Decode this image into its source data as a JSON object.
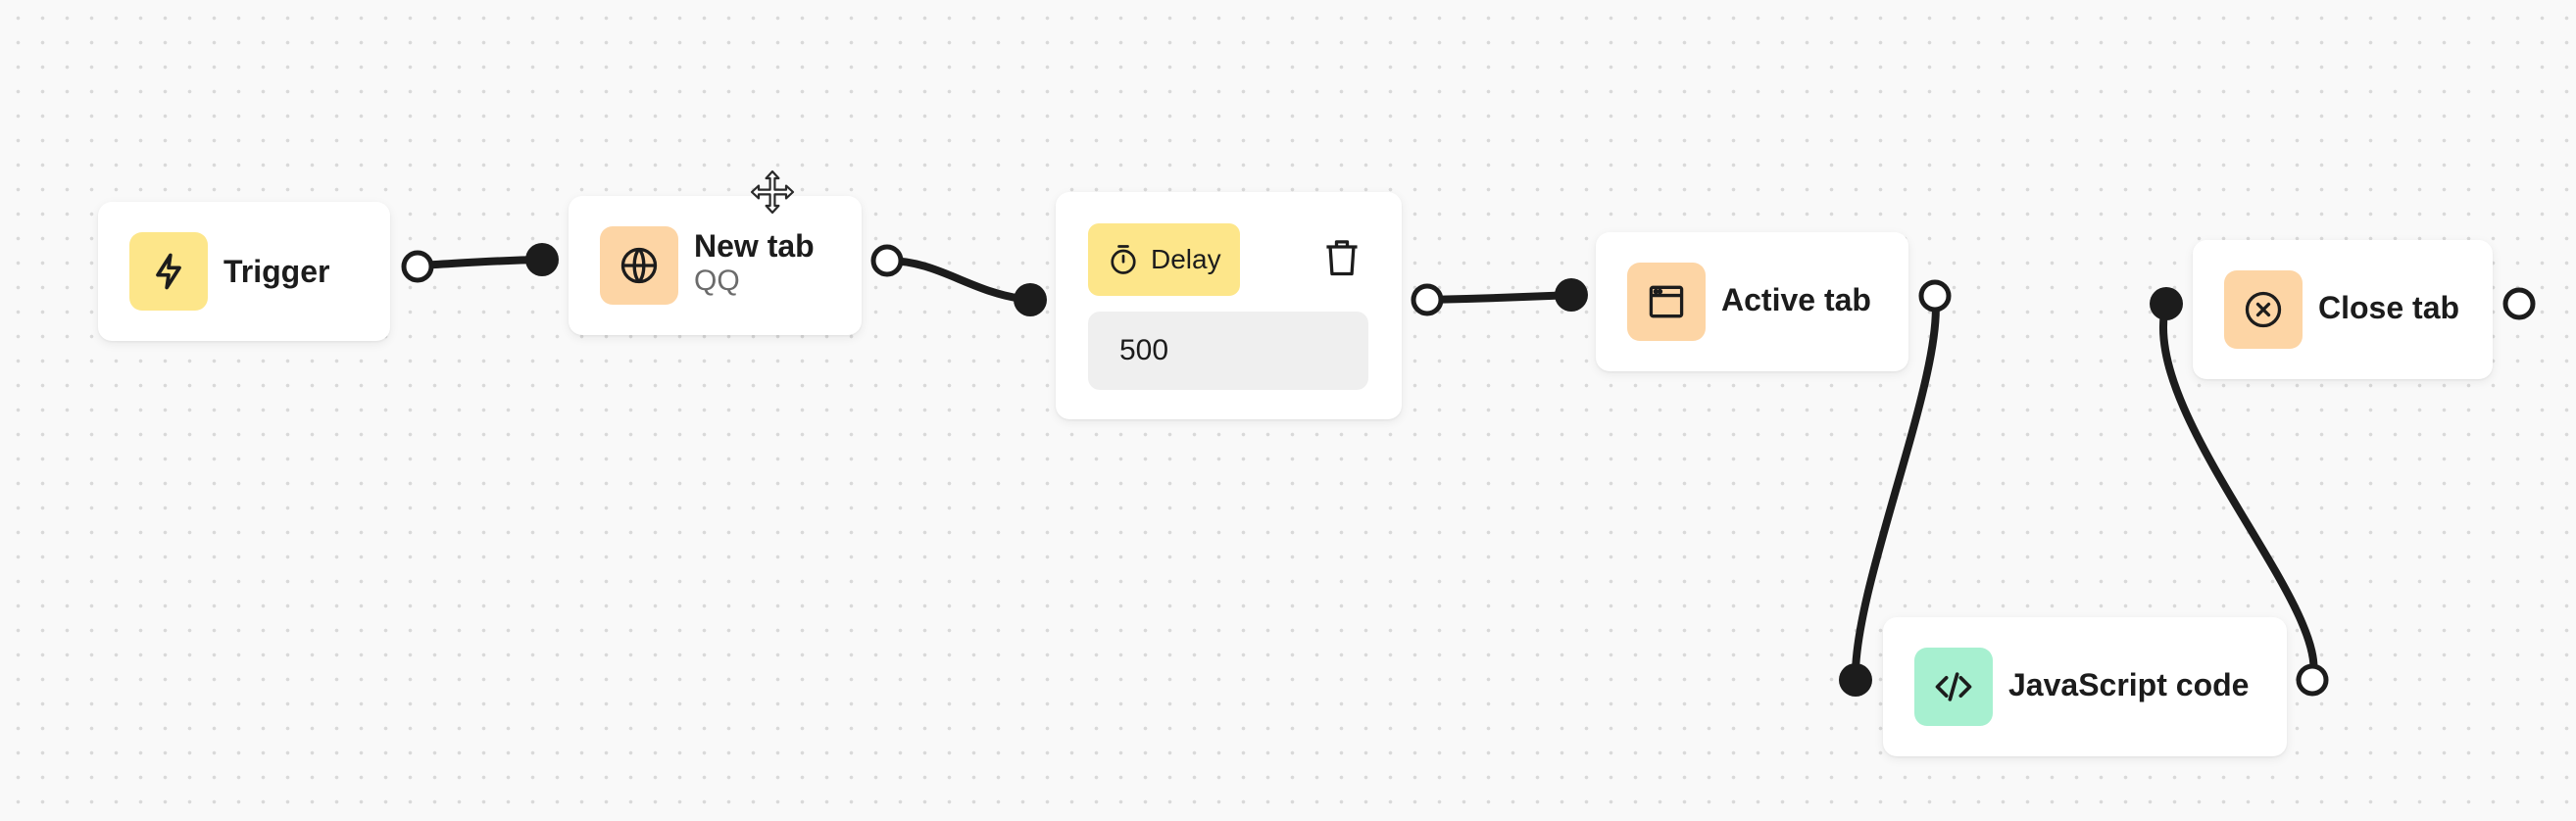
{
  "colors": {
    "yellow": "#fde68a",
    "orange": "#fdd5a5",
    "green": "#a7f0d0",
    "edge": "#1c1c1c"
  },
  "nodes": {
    "trigger": {
      "title": "Trigger",
      "icon": "bolt-icon"
    },
    "new_tab": {
      "title": "New tab",
      "subtitle": "QQ",
      "icon": "globe-icon"
    },
    "delay": {
      "label": "Delay",
      "value": "500",
      "icon": "stopwatch-icon",
      "action_icon": "trash-icon"
    },
    "active_tab": {
      "title": "Active tab",
      "icon": "browser-window-icon"
    },
    "close_tab": {
      "title": "Close tab",
      "icon": "close-circle-icon"
    },
    "javascript_code": {
      "title": "JavaScript code",
      "icon": "code-icon"
    }
  },
  "cursor": {
    "icon": "move-cursor-icon"
  }
}
